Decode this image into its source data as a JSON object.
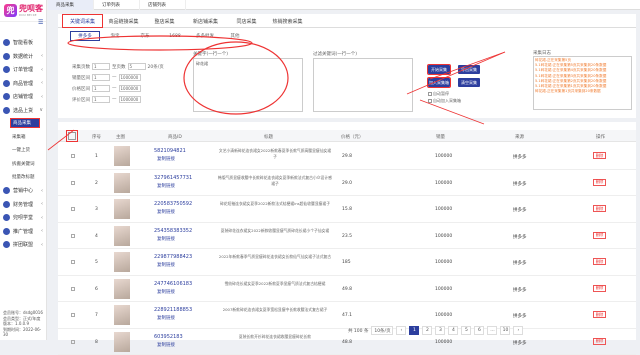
{
  "app": {
    "logo_text": "兜呗客",
    "logo_sub": "DOU BEI KE",
    "logo_mark": "兜"
  },
  "top_tabs": [
    "商品采集",
    "订单列表",
    "店铺列表"
  ],
  "sidebar": {
    "items": [
      {
        "label": "智能看板",
        "icon": "dashboard-icon"
      },
      {
        "label": "数据统计",
        "icon": "chart-icon",
        "arrow": "‹"
      },
      {
        "label": "订单管理",
        "icon": "order-icon",
        "arrow": "‹"
      },
      {
        "label": "商品管理",
        "icon": "goods-icon",
        "arrow": "‹"
      },
      {
        "label": "店铺管理",
        "icon": "shop-icon",
        "arrow": "‹"
      },
      {
        "label": "选品上货",
        "icon": "upload-icon",
        "arrow": "∨"
      }
    ],
    "sub_items": [
      "商品采集",
      "采集箱",
      "一键上货",
      "拆搬关键词",
      "批量改标题"
    ],
    "items2": [
      {
        "label": "营销中心",
        "icon": "marketing-icon",
        "arrow": "‹"
      },
      {
        "label": "财务管理",
        "icon": "finance-icon",
        "arrow": "‹"
      },
      {
        "label": "兜呗学堂",
        "icon": "school-icon",
        "arrow": "‹"
      },
      {
        "label": "推广管理",
        "icon": "promo-icon",
        "arrow": "‹"
      },
      {
        "label": "拼团联盟",
        "icon": "group-icon",
        "arrow": "‹"
      }
    ],
    "footer": [
      "会员账号：dsdg0016",
      "会员类型：正式/年度",
      "版本：1.0.0.9",
      "到期时间：2022-06-30"
    ]
  },
  "content_tabs": [
    "关键词采集",
    "商品链接采集",
    "整店采集",
    "新店铺采集",
    "同店采集",
    "热销搜索采集"
  ],
  "platform_tabs": [
    "拼多多",
    "淘宝",
    "京东",
    "1688",
    "多多批发",
    "其他"
  ],
  "filters": {
    "pages_label": "采集页数",
    "pages_from": "1",
    "pages_to_label": "至页数",
    "pages_to": "5",
    "pages_unit": "20条/页",
    "sales_label": "销量区间",
    "sales_from": "1",
    "sales_to": "1000000",
    "price_label": "价格区间",
    "price_from": "1",
    "price_to": "1000000",
    "rating_label": "评价区间",
    "rating_from": "1",
    "rating_to": "1000000"
  },
  "keyword_box": {
    "label": "关键字(一行一个)",
    "value": "碎花裙"
  },
  "filter_box": {
    "label": "过滤关键词(一行一个)",
    "value": ""
  },
  "buttons": {
    "start": "开始采集",
    "export": "导出采集",
    "add_box": "加入采集箱",
    "clear": "清空采集",
    "stop": "停止"
  },
  "options": {
    "auto_stop": "自动暂停",
    "auto_add": "自动加入采集箱"
  },
  "log": {
    "title": "采集日志",
    "lines": [
      "碎花裙-正在采集第5页",
      "5.1碎花裙:正在采集第5页共采集到20条数据",
      "5.1碎花裙:正在采集第4页共采集到20条数据",
      "5.1碎花裙:正在采集第3页共采集到20条数据",
      "5.1碎花裙:正在采集第2页共采集到20条数据",
      "5.1碎花裙:正在采集第1页共采集到20条数据",
      "碎花裙-正在采集第1页共采集到20条数据"
    ]
  },
  "table": {
    "headers": [
      "序号",
      "主图",
      "商品ID",
      "标题",
      "价格（元）",
      "销量",
      "来源",
      "操作"
    ],
    "copy_label": "复制链接",
    "delete_label": "删除",
    "rows": [
      {
        "no": "1",
        "id": "5821094821",
        "title": "文艺小清新碎花连衣裙女2022新款春夏季长款气质高腰显瘦仙女裙子",
        "price": "29.8",
        "sales": "100000",
        "source": "拼多多"
      },
      {
        "no": "2",
        "id": "327961457731",
        "title": "韩版气质显瘦收腰中长款碎花连衣裙女夏季新款法式复古小众设计感裙子",
        "price": "29.0",
        "sales": "100000",
        "source": "拼多多"
      },
      {
        "no": "3",
        "id": "220583750592",
        "title": "碎花短袖连衣裙女夏季2022新款法式桔梗裙ins超仙收腰显瘦裙子",
        "price": "15.8",
        "sales": "100000",
        "source": "拼多多"
      },
      {
        "no": "4",
        "id": "254358383352",
        "title": "夏装碎花连衣裙女2022新款收腰显瘦气质碎花长裙小个子仙女裙",
        "price": "23.5",
        "sales": "100000",
        "source": "拼多多"
      },
      {
        "no": "5",
        "id": "229877988423",
        "title": "2022年新款春季气质显瘦碎花连衣裙女长款仙气仙女裙子法式复古",
        "price": "185",
        "sales": "100000",
        "source": "拼多多"
      },
      {
        "no": "6",
        "id": "247746106183",
        "title": "雪纺碎花长裙女夏季2022新款夏季显瘦气质法式复古桔梗裙",
        "price": "49.8",
        "sales": "100000",
        "source": "拼多多"
      },
      {
        "no": "7",
        "id": "228921188853",
        "title": "2007新款碎花连衣裙女夏季宽松显瘦中长款收腰法式复古裙子",
        "price": "47.1",
        "sales": "100000",
        "source": "拼多多"
      },
      {
        "no": "8",
        "id": "603952183",
        "title": "夏装长款开衫碎花连衣裙收腰显瘦碎花长款",
        "price": "48.8",
        "sales": "100000",
        "source": "拼多多"
      }
    ]
  },
  "pager": {
    "total": "共 100 条",
    "size": "10条/页",
    "pages": [
      "‹",
      "1",
      "2",
      "3",
      "4",
      "5",
      "6",
      "…",
      "10",
      "›"
    ],
    "current": "1"
  }
}
